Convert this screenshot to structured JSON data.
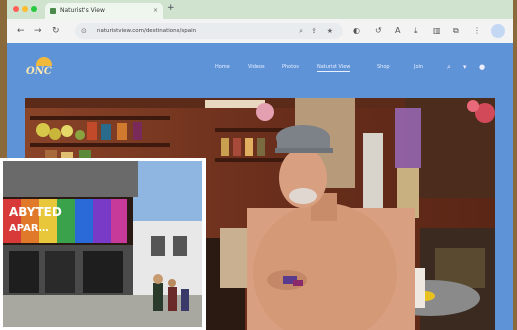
{
  "browser": {
    "tab_title": "Naturist's View",
    "tab_close": "×",
    "new_tab": "+",
    "back": "←",
    "forward": "→",
    "reload": "↻",
    "url": "naturistview.com/destinations/spain",
    "icons": [
      "lock-icon",
      "zoom-icon",
      "share-icon",
      "star-icon",
      "extensions-icon",
      "profile-icon",
      "menu-icon"
    ]
  },
  "site": {
    "logo_text": "ONC",
    "nav": [
      "Home",
      "Videos",
      "Photos",
      "Naturist View",
      "Shop",
      "Join"
    ],
    "active_nav_index": 3
  },
  "colors": {
    "site_header": "#5f93d8",
    "tabstrip": "#cfe3cf",
    "logo_sun": "#f0b93a"
  }
}
